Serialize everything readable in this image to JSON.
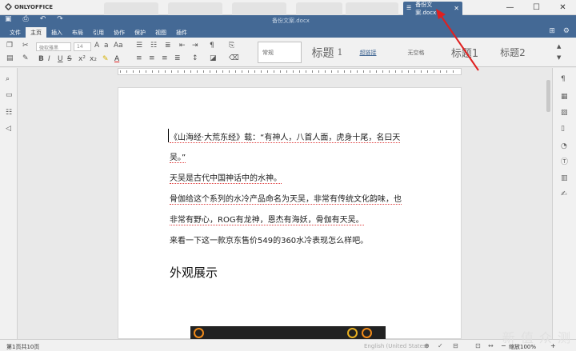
{
  "app": {
    "name": "ONLYOFFICE",
    "doc_title": "备份文案.docx"
  },
  "tabs": {
    "active_label": "备份文案.docx"
  },
  "menu": [
    "文件",
    "主页",
    "插入",
    "布局",
    "引用",
    "协作",
    "保护",
    "视图",
    "插件"
  ],
  "ribbon": {
    "font_name": "微软雅黑",
    "font_size": "14",
    "styles": [
      "常规",
      "标题",
      "1",
      "超链接",
      "无空格",
      "标题1",
      "标题2"
    ]
  },
  "document": {
    "lines": [
      "《山海经·大荒东经》载：“有神人，八首人面，虎身十尾，名曰天",
      "吴。”",
      "天吴是古代中国神话中的水神。",
      "骨伽给这个系列的水冷产品命名为天吴，非常有传统文化韵味，也",
      "非常有野心，ROG有龙神，恩杰有海妖，骨伽有天吴。",
      "来看一下这一款京东售价549的360水冷表现怎么样吧。"
    ],
    "heading": "外观展示"
  },
  "status": {
    "page_info": "第1页共10页",
    "language": "English (United States)",
    "zoom": "缩放100%"
  },
  "watermark": "新 值 众 测",
  "colors": {
    "accent": "#446995",
    "annotation_arrow": "#e02020"
  },
  "icons": [
    "save-icon",
    "print-icon",
    "undo-icon",
    "redo-icon",
    "search-icon",
    "comment-icon",
    "chat-icon",
    "feedback-icon",
    "paragraph-icon",
    "table-icon",
    "image-icon",
    "header-icon",
    "shape-icon",
    "textart-icon",
    "signature-icon",
    "minimize-icon",
    "maximize-icon",
    "close-icon"
  ]
}
